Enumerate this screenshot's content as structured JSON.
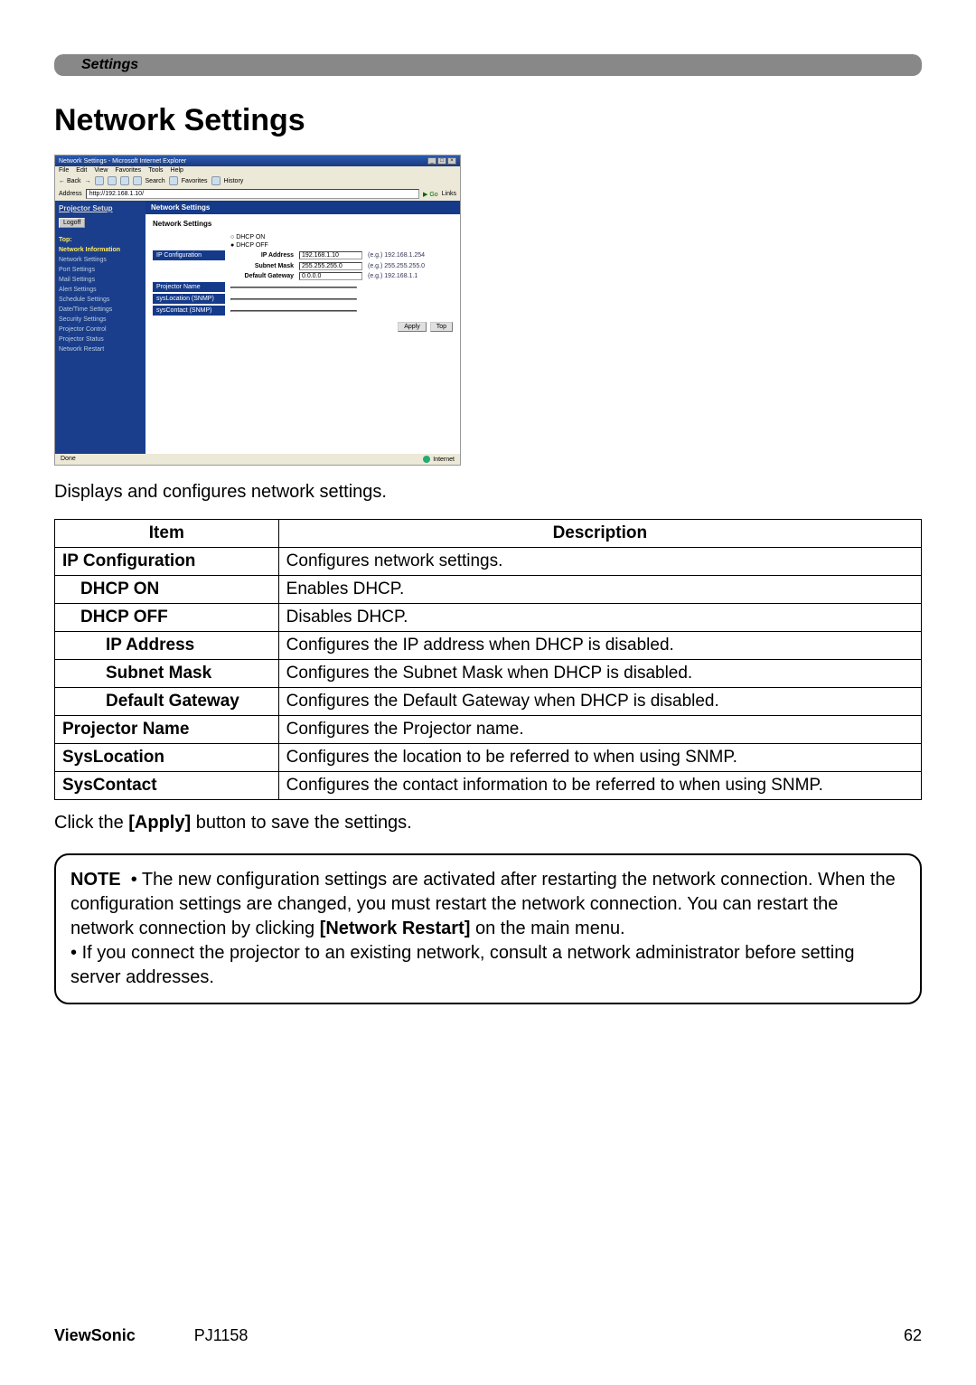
{
  "header_bar": "Settings",
  "section_title": "Network Settings",
  "browser": {
    "title": "Network Settings - Microsoft Internet Explorer",
    "menus": [
      "File",
      "Edit",
      "View",
      "Favorites",
      "Tools",
      "Help"
    ],
    "back": "Back",
    "toolbar_labels": [
      "Search",
      "Favorites",
      "History"
    ],
    "address_label": "Address",
    "address_value": "http://192.168.1.10/",
    "go_label": "Go",
    "links_label": "Links",
    "sidebar": {
      "title": "Projector Setup",
      "logoff": "Logoff",
      "top_label": "Top:",
      "heading": "Network Information",
      "items": [
        "Network Settings",
        "Port Settings",
        "Mail Settings",
        "Alert Settings",
        "Schedule Settings",
        "Date/Time Settings",
        "Security Settings",
        "Projector Control",
        "Projector Status",
        "Network Restart"
      ]
    },
    "main": {
      "pane_title": "Network Settings",
      "sub_heading": "Network Settings",
      "ip_config_label": "IP Configuration",
      "dhcp_on": "DHCP ON",
      "dhcp_off": "DHCP OFF",
      "ip_address_label": "IP Address",
      "ip_address_value": "192.168.1.10",
      "ip_address_hint": "(e.g.) 192.168.1.254",
      "subnet_label": "Subnet Mask",
      "subnet_value": "255.255.255.0",
      "subnet_hint": "(e.g.) 255.255.255.0",
      "gateway_label": "Default Gateway",
      "gateway_value": "0.0.0.0",
      "gateway_hint": "(e.g.) 192.168.1.1",
      "projector_name_label": "Projector Name",
      "syslocation_label": "sysLocation (SNMP)",
      "syscontact_label": "sysContact (SNMP)",
      "apply": "Apply",
      "top": "Top"
    },
    "status_done": "Done",
    "status_zone": "Internet"
  },
  "intro": "Displays and configures network settings.",
  "table": {
    "head_item": "Item",
    "head_desc": "Description",
    "rows": [
      {
        "item": "IP Configuration",
        "desc": "Configures network settings.",
        "indent": 0
      },
      {
        "item": "DHCP ON",
        "desc": "Enables DHCP.",
        "indent": 1
      },
      {
        "item": "DHCP OFF",
        "desc": "Disables DHCP.",
        "indent": 1
      },
      {
        "item": "IP Address",
        "desc": "Configures the IP address when DHCP is disabled.",
        "indent": 2
      },
      {
        "item": "Subnet Mask",
        "desc": "Configures the Subnet Mask when DHCP is disabled.",
        "indent": 2
      },
      {
        "item": "Default Gateway",
        "desc": "Configures the Default Gateway when DHCP is disabled.",
        "indent": 2
      },
      {
        "item": "Projector Name",
        "desc": "Configures the Projector name.",
        "indent": 0
      },
      {
        "item": "SysLocation",
        "desc": "Configures the location to be referred to when using SNMP.",
        "indent": 0
      },
      {
        "item": "SysContact",
        "desc": "Configures the contact information to be referred to when using SNMP.",
        "indent": 0
      }
    ]
  },
  "after_table_pre": "Click the ",
  "after_table_bold": "[Apply]",
  "after_table_post": " button to save the settings.",
  "note": {
    "label": "NOTE",
    "bullet": "•",
    "text1a": " The new configuration settings are activated after restarting the network connection. When the configuration settings are changed, you must restart the network connection. You can restart the network connection by clicking ",
    "text1b": "[Network Restart]",
    "text1c": " on the main menu.",
    "text2": " If you connect the projector to an existing network, consult a network administrator before setting server addresses."
  },
  "footer": {
    "brand": "ViewSonic",
    "model": "PJ1158",
    "page": "62"
  }
}
